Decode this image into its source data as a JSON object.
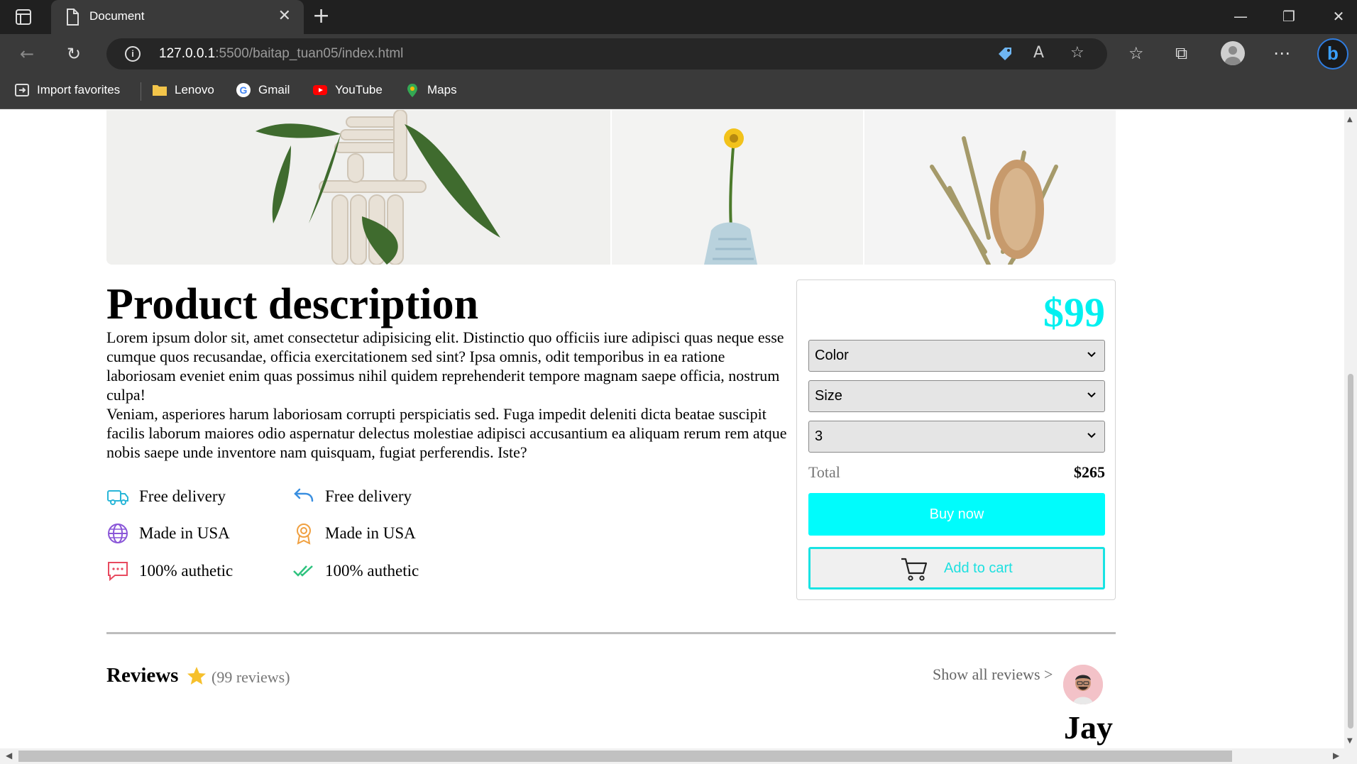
{
  "browser": {
    "tab_title": "Document",
    "tab_close": "✕",
    "new_tab": "+",
    "url_host": "127.0.0.1",
    "url_path": ":5500/baitap_tuan05/index.html",
    "favorites": [
      {
        "label": "Import favorites",
        "icon": "import-favorites-icon"
      },
      {
        "label": "Lenovo",
        "icon": "folder-icon"
      },
      {
        "label": "Gmail",
        "icon": "google-icon"
      },
      {
        "label": "YouTube",
        "icon": "youtube-icon"
      },
      {
        "label": "Maps",
        "icon": "maps-icon"
      }
    ]
  },
  "product": {
    "title": "Product description",
    "paragraph1": "Lorem ipsum dolor sit, amet consectetur adipisicing elit. Distinctio quo officiis iure adipisci quas neque esse cumque quos recusandae, officia exercitationem sed sint? Ipsa omnis, odit temporibus in ea ratione laboriosam eveniet enim quas possimus nihil quidem reprehenderit tempore magnam saepe officia, nostrum culpa!",
    "paragraph2": "Veniam, asperiores harum laboriosam corrupti perspiciatis sed. Fuga impedit deleniti dicta beatae suscipit facilis laborum maiores odio aspernatur delectus molestiae adipisci accusantium ea aliquam rerum rem atque nobis saepe unde inventore nam quisquam, fugiat perferendis. Iste?",
    "features": [
      {
        "label": "Free delivery",
        "icon": "truck-icon",
        "color": "#29b6d8"
      },
      {
        "label": "Free delivery",
        "icon": "return-arrow-icon",
        "color": "#3a8fe0"
      },
      {
        "label": "Made in USA",
        "icon": "globe-icon",
        "color": "#8a56d8"
      },
      {
        "label": "Made in USA",
        "icon": "award-icon",
        "color": "#f0a040"
      },
      {
        "label": "100% authetic",
        "icon": "chat-icon",
        "color": "#e84a5f"
      },
      {
        "label": "100% authetic",
        "icon": "double-check-icon",
        "color": "#2ec27e"
      }
    ]
  },
  "buybox": {
    "price": "$99",
    "color_select": "Color",
    "size_select": "Size",
    "quantity_select": "3",
    "total_label": "Total",
    "total_value": "$265",
    "buy_now": "Buy now",
    "add_to_cart": "Add to cart",
    "accent_color": "#00fcfc"
  },
  "reviews": {
    "title": "Reviews",
    "count": "(99 reviews)",
    "show_all": "Show all reviews >",
    "reviewer_name": "Jay"
  }
}
